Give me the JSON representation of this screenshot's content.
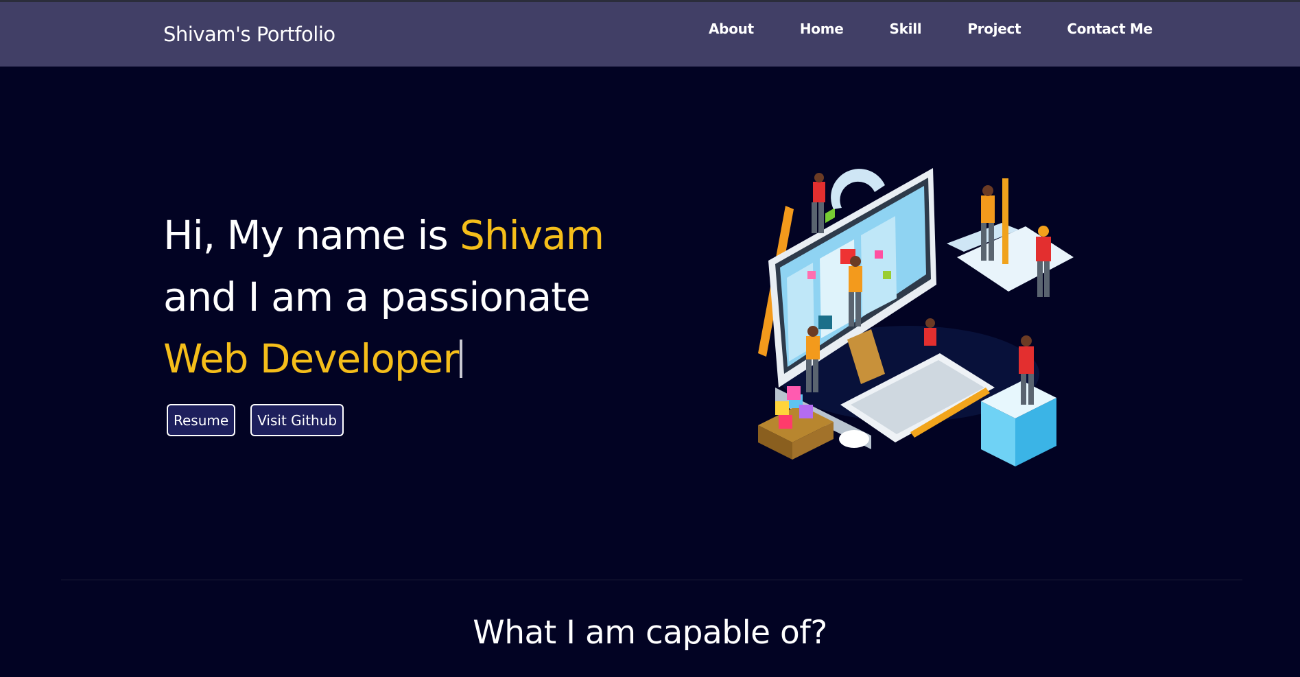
{
  "header": {
    "brand": "Shivam's Portfolio",
    "nav": [
      "About",
      "Home",
      "Skill",
      "Project",
      "Contact Me"
    ]
  },
  "hero": {
    "line1_prefix": "Hi, My name is ",
    "name": "Shivam",
    "line2": "and I am a passionate",
    "role": "Web Developer",
    "buttons": {
      "resume": "Resume",
      "github": "Visit Github"
    },
    "illustration": "developer-team-workspace-illustration"
  },
  "section": {
    "title": "What I am capable of?"
  },
  "colors": {
    "background": "#020323",
    "navbar": "#413f66",
    "accent": "#f5be1a",
    "button": "#1d1f5c"
  }
}
